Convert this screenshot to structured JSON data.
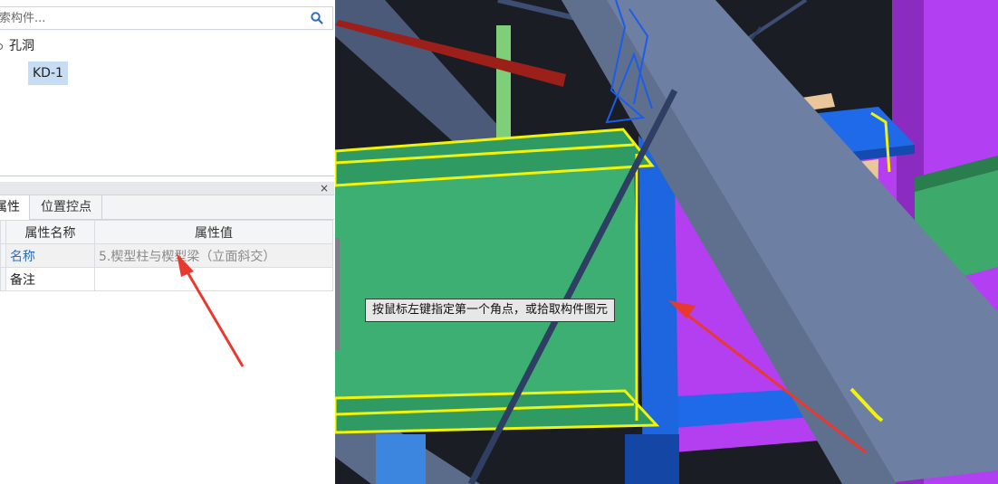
{
  "search": {
    "placeholder": "索构件..."
  },
  "tree": {
    "root_label": "孔洞",
    "child_label": "KD-1"
  },
  "properties_panel": {
    "close_glyph": "×",
    "tabs": [
      {
        "label": "属性"
      },
      {
        "label": "位置控点"
      }
    ],
    "columns": {
      "name": "属性名称",
      "value": "属性值"
    },
    "rows": [
      {
        "name": "名称",
        "value": "5.楔型柱与楔型梁（立面斜交）"
      },
      {
        "name": "备注",
        "value": ""
      }
    ]
  },
  "viewport": {
    "status_tip": "按鼠标左键指定第一个角点，或拾取构件图元"
  },
  "colors": {
    "annotation_arrow": "#e8392f",
    "selection_highlight": "#f2f20a",
    "beam_green": "#3daf72",
    "column_magenta": "#b13bf0",
    "steel_blue": "#1f6ae8",
    "member_gray": "#6b7d9c"
  }
}
